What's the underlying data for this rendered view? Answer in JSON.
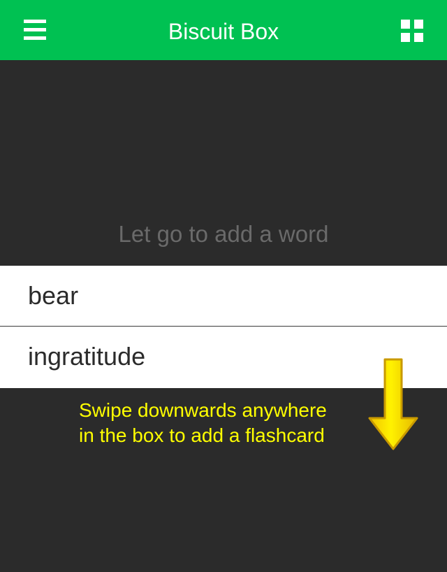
{
  "app": {
    "title": "Biscuit Box"
  },
  "header": {
    "menu_icon": "hamburger-menu-icon",
    "grid_icon": "grid-view-icon",
    "background_color": "#00c152"
  },
  "drop_zone": {
    "hint": "Let go to add a word"
  },
  "words": [
    {
      "text": "bear"
    },
    {
      "text": "ingratitude"
    }
  ],
  "tutorial": {
    "line1": "Swipe downwards anywhere",
    "line2": "in the box to add a flashcard",
    "arrow_icon": "down-arrow-icon",
    "text_color": "#ffff00"
  }
}
